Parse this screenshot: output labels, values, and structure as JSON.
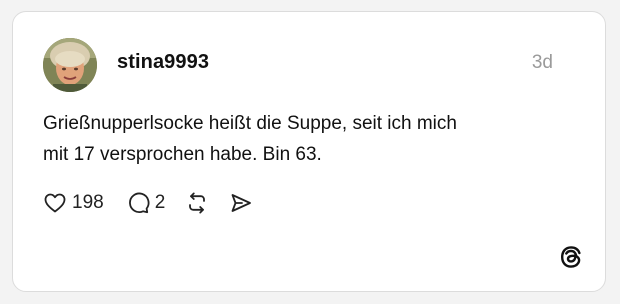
{
  "post": {
    "username": "stina9993",
    "timestamp": "3d",
    "text_lines": [
      "Grießnupperlsocke heißt die Suppe, seit ich mich",
      "mit 17 versprochen habe. Bin 63."
    ],
    "likes": "198",
    "replies": "2"
  },
  "icons": {
    "like": "heart-icon",
    "reply": "speech-bubble-icon",
    "repost": "repost-arrows-icon",
    "share": "send-arrow-icon",
    "brand": "threads-logo-icon"
  },
  "colors": {
    "card_background": "#ffffff",
    "card_border": "#dcdcdc",
    "text": "#111111",
    "muted": "#9a9a9a"
  }
}
